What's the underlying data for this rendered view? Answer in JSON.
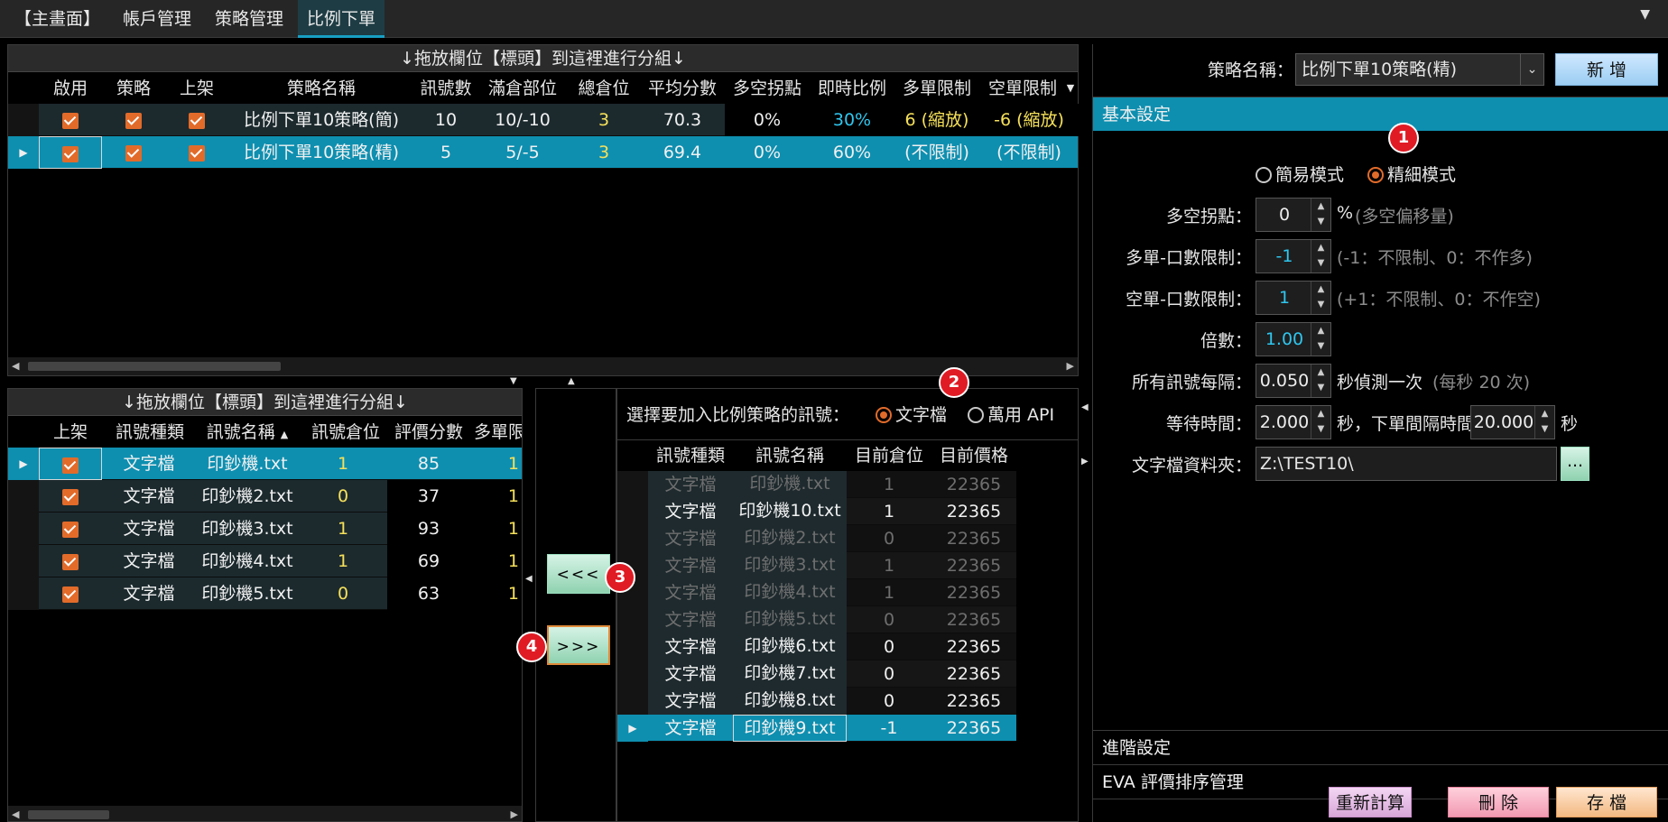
{
  "menu": {
    "items": [
      "【主畫面】",
      "帳戶管理",
      "策略管理",
      "比例下單"
    ],
    "active": "比例下單"
  },
  "strategy_table": {
    "group_hint": "↓拖放欄位【標頭】到這裡進行分組↓",
    "columns": [
      "啟用",
      "策略",
      "上架",
      "策略名稱",
      "訊號數",
      "滿倉部位",
      "總倉位",
      "平均分數",
      "多空拐點",
      "即時比例",
      "多單限制",
      "空單限制"
    ],
    "rows": [
      {
        "name": "比例下單10策略(簡)",
        "signals": "10",
        "full": "10/-10",
        "total": "3",
        "avg": "70.3",
        "pivot": "0%",
        "ratio": "30%",
        "long_limit": "6 (縮放)",
        "short_limit": "-6 (縮放)"
      },
      {
        "name": "比例下單10策略(精)",
        "signals": "5",
        "full": "5/-5",
        "total": "3",
        "avg": "69.4",
        "pivot": "0%",
        "ratio": "60%",
        "long_limit": "(不限制)",
        "short_limit": "(不限制)"
      }
    ]
  },
  "signal_table": {
    "group_hint": "↓拖放欄位【標頭】到這裡進行分組↓",
    "columns": [
      "上架",
      "訊號種類",
      "訊號名稱",
      "訊號倉位",
      "評價分數",
      "多單限"
    ],
    "rows": [
      {
        "type": "文字檔",
        "name": "印鈔機.txt",
        "pos": "1",
        "score": "85",
        "limit": "1"
      },
      {
        "type": "文字檔",
        "name": "印鈔機2.txt",
        "pos": "0",
        "score": "37",
        "limit": "1"
      },
      {
        "type": "文字檔",
        "name": "印鈔機3.txt",
        "pos": "1",
        "score": "93",
        "limit": "1"
      },
      {
        "type": "文字檔",
        "name": "印鈔機4.txt",
        "pos": "1",
        "score": "69",
        "limit": "1"
      },
      {
        "type": "文字檔",
        "name": "印鈔機5.txt",
        "pos": "0",
        "score": "63",
        "limit": "1"
      }
    ]
  },
  "mover": {
    "add_label": "<<<",
    "remove_label": ">>>"
  },
  "source": {
    "prompt": "選擇要加入比例策略的訊號：",
    "opt_text": "文字檔",
    "opt_api": "萬用 API",
    "columns": [
      "訊號種類",
      "訊號名稱",
      "目前倉位",
      "目前價格"
    ],
    "rows": [
      {
        "type": "文字檔",
        "name": "印鈔機.txt",
        "pos": "1",
        "price": "22365",
        "dim": true
      },
      {
        "type": "文字檔",
        "name": "印鈔機10.txt",
        "pos": "1",
        "price": "22365",
        "dim": false
      },
      {
        "type": "文字檔",
        "name": "印鈔機2.txt",
        "pos": "0",
        "price": "22365",
        "dim": true
      },
      {
        "type": "文字檔",
        "name": "印鈔機3.txt",
        "pos": "1",
        "price": "22365",
        "dim": true
      },
      {
        "type": "文字檔",
        "name": "印鈔機4.txt",
        "pos": "1",
        "price": "22365",
        "dim": true
      },
      {
        "type": "文字檔",
        "name": "印鈔機5.txt",
        "pos": "0",
        "price": "22365",
        "dim": true
      },
      {
        "type": "文字檔",
        "name": "印鈔機6.txt",
        "pos": "0",
        "price": "22365",
        "dim": false
      },
      {
        "type": "文字檔",
        "name": "印鈔機7.txt",
        "pos": "0",
        "price": "22365",
        "dim": false
      },
      {
        "type": "文字檔",
        "name": "印鈔機8.txt",
        "pos": "0",
        "price": "22365",
        "dim": false
      },
      {
        "type": "文字檔",
        "name": "印鈔機9.txt",
        "pos": "-1",
        "price": "22365",
        "dim": false
      }
    ]
  },
  "settings": {
    "strategy_label": "策略名稱：",
    "strategy_value": "比例下單10策略(精)",
    "add_button": "新 增",
    "basic_section": "基本設定",
    "mode_simple": "簡易模式",
    "mode_detail": "精細模式",
    "pivot_label": "多空拐點：",
    "pivot_value": "0",
    "pivot_unit": "%",
    "pivot_note": "(多空偏移量)",
    "long_label": "多單-口數限制：",
    "long_value": "-1",
    "long_note": "(-1：不限制、0：不作多)",
    "short_label": "空單-口數限制：",
    "short_value": "1",
    "short_note": "(+1：不限制、0：不作空)",
    "mult_label": "倍數：",
    "mult_value": "1.00",
    "interval_label": "所有訊號每隔：",
    "interval_value": "0.050",
    "interval_unit": "秒偵測一次",
    "interval_note": "(每秒 20 次)",
    "wait_label": "等待時間：",
    "wait_value": "2.000",
    "wait_unit": "秒，下單間隔時間：",
    "order_value": "20.000",
    "order_unit": "秒",
    "folder_label": "文字檔資料夾：",
    "folder_value": "Z:\\TEST10\\",
    "browse": "...",
    "advanced_section": "進階設定",
    "eva_section": "EVA 評價排序管理",
    "recalc": "重新計算",
    "delete": "刪 除",
    "save": "存 檔"
  },
  "badges": [
    "1",
    "2",
    "3",
    "4"
  ],
  "colors": {
    "accent": "#0e8fb0",
    "checkbox": "#e26b2a",
    "highlight_yellow": "#f5e05a",
    "highlight_cyan": "#2fc6ee"
  }
}
